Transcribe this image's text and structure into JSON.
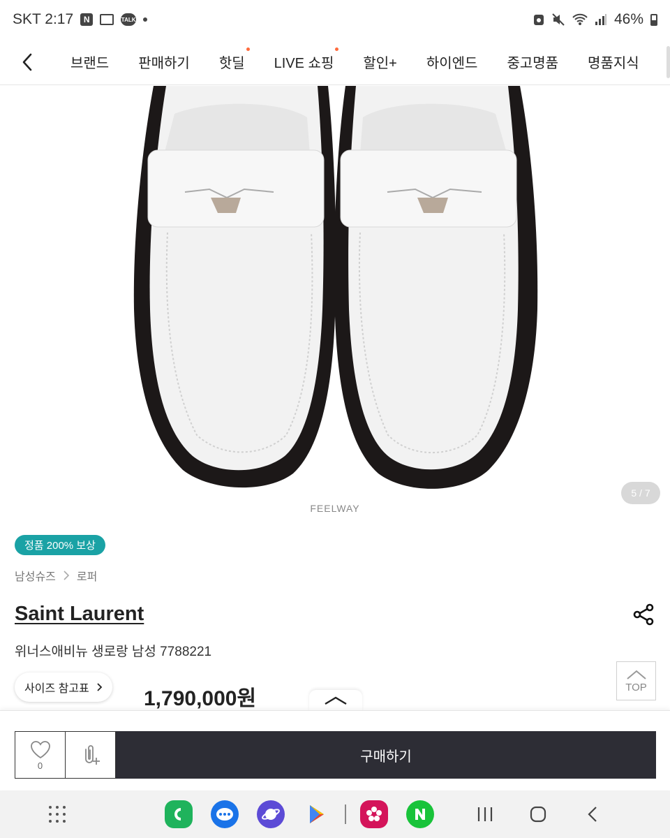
{
  "status": {
    "carrier_time": "SKT 2:17",
    "notif_icons": [
      "naver-icon",
      "card-icon",
      "talk-icon"
    ],
    "battery": "46%",
    "talk_label": "TALK",
    "n_label": "N"
  },
  "nav": {
    "tabs": [
      {
        "label": "브랜드",
        "dot": false
      },
      {
        "label": "판매하기",
        "dot": false
      },
      {
        "label": "핫딜",
        "dot": true
      },
      {
        "label": "LIVE 쇼핑",
        "dot": true
      },
      {
        "label": "할인+",
        "dot": false
      },
      {
        "label": "하이엔드",
        "dot": false
      },
      {
        "label": "중고명품",
        "dot": false
      },
      {
        "label": "명품지식",
        "dot": false
      }
    ]
  },
  "gallery": {
    "pager": "5 / 7",
    "watermark": "FEELWAY"
  },
  "product": {
    "badge": "정품 200% 보상",
    "breadcrumb": [
      "남성슈즈",
      "로퍼"
    ],
    "brand": "Saint Laurent",
    "name": "위너스애비뉴 생로랑 남성 7788221",
    "size_chip": "사이즈 참고표",
    "price": "1,790,000원",
    "top_label": "TOP"
  },
  "buybar": {
    "wish_count": "0",
    "buy_label": "구매하기"
  },
  "colors": {
    "badge": "#1aa2a5",
    "buy_button": "#2d2d35",
    "nav_dot": "#ff6b3d"
  },
  "dock": {
    "apps": [
      {
        "name": "phone-app-icon",
        "color": "#1fb35c",
        "glyph": "C"
      },
      {
        "name": "messages-app-icon",
        "color": "#1a73e8",
        "glyph": "…"
      },
      {
        "name": "internet-app-icon",
        "color": "#5c4bd6",
        "glyph": "e"
      },
      {
        "name": "play-store-icon",
        "color": "#ffffff",
        "glyph": "▶"
      },
      {
        "name": "flower-app-icon",
        "color": "#d4145a",
        "glyph": "✿"
      },
      {
        "name": "naver-app-icon",
        "color": "#19c33a",
        "glyph": "N"
      }
    ]
  }
}
